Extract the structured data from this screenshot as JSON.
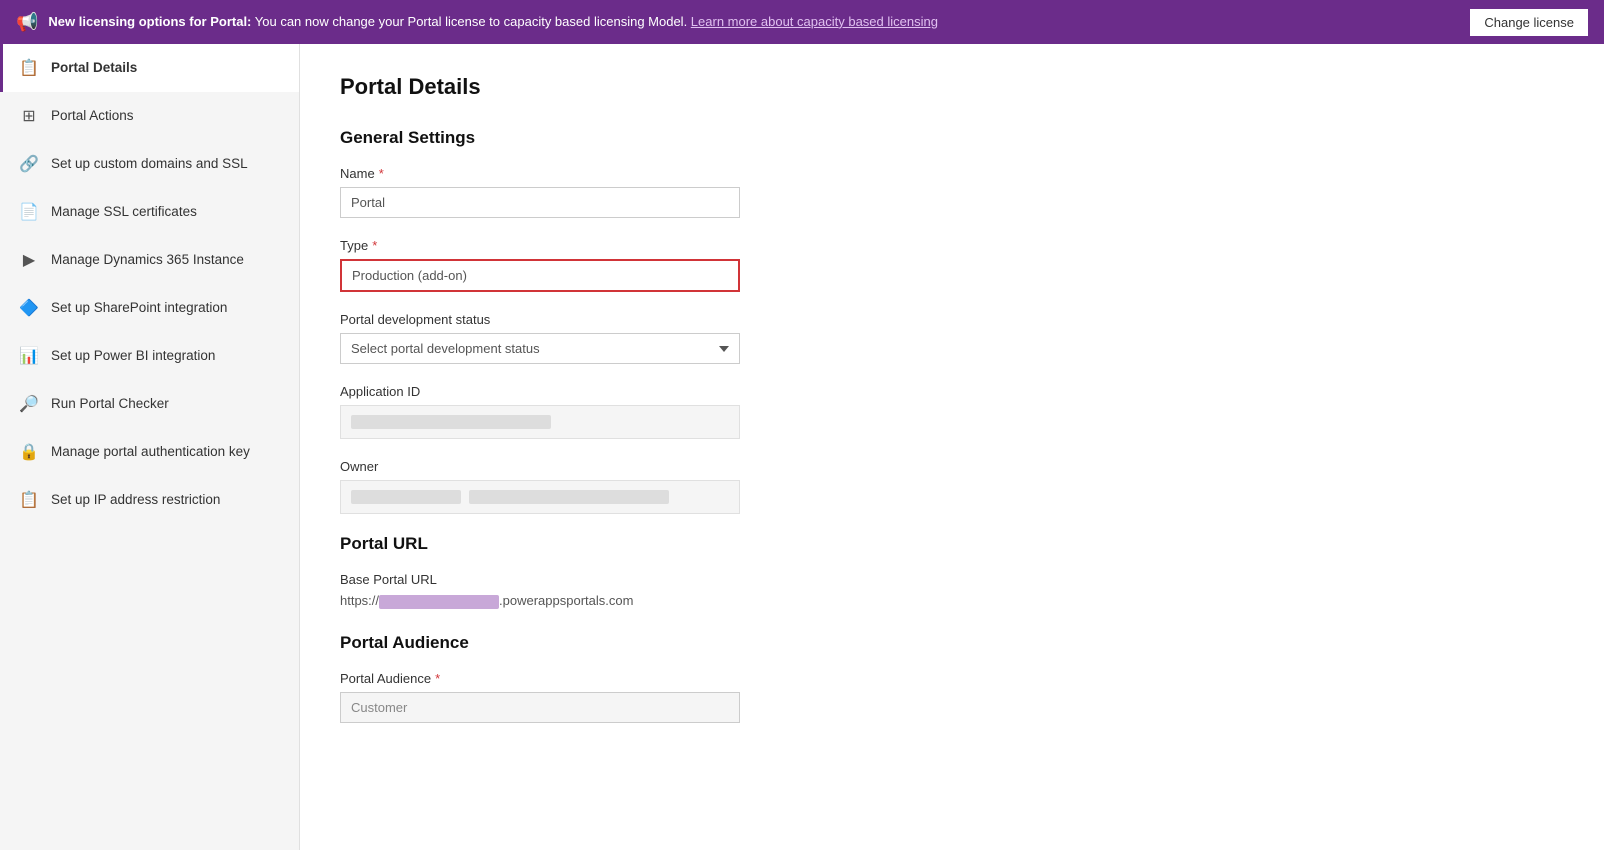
{
  "banner": {
    "icon": "📢",
    "text_prefix": "New licensing options for Portal:",
    "text_body": " You can now change your Portal license to capacity based licensing Model. ",
    "link_text": "Learn more about capacity based licensing",
    "button_label": "Change license"
  },
  "sidebar": {
    "items": [
      {
        "id": "portal-details",
        "label": "Portal Details",
        "icon": "📋",
        "active": true
      },
      {
        "id": "portal-actions",
        "label": "Portal Actions",
        "icon": "⊞",
        "active": false
      },
      {
        "id": "custom-domains",
        "label": "Set up custom domains and SSL",
        "icon": "🔗",
        "active": false
      },
      {
        "id": "ssl-certs",
        "label": "Manage SSL certificates",
        "icon": "📄",
        "active": false
      },
      {
        "id": "dynamics-instance",
        "label": "Manage Dynamics 365 Instance",
        "icon": "▶",
        "active": false
      },
      {
        "id": "sharepoint",
        "label": "Set up SharePoint integration",
        "icon": "🔷",
        "active": false
      },
      {
        "id": "powerbi",
        "label": "Set up Power BI integration",
        "icon": "📊",
        "active": false
      },
      {
        "id": "portal-checker",
        "label": "Run Portal Checker",
        "icon": "🔎",
        "active": false
      },
      {
        "id": "auth-key",
        "label": "Manage portal authentication key",
        "icon": "🔒",
        "active": false
      },
      {
        "id": "ip-restriction",
        "label": "Set up IP address restriction",
        "icon": "📋",
        "active": false
      }
    ]
  },
  "content": {
    "page_title": "Portal Details",
    "general_settings": {
      "section_title": "General Settings",
      "name_label": "Name",
      "name_required": "*",
      "name_value": "Portal",
      "type_label": "Type",
      "type_required": "*",
      "type_value": "Production (add-on)",
      "portal_dev_status_label": "Portal development status",
      "portal_dev_status_placeholder": "Select portal development status",
      "app_id_label": "Application ID",
      "owner_label": "Owner"
    },
    "portal_url": {
      "section_title": "Portal URL",
      "base_url_label": "Base Portal URL",
      "base_url_prefix": "https://",
      "base_url_suffix": ".powerappsportals.com"
    },
    "portal_audience": {
      "section_title": "Portal Audience",
      "audience_label": "Portal Audience",
      "audience_required": "*",
      "audience_value": "Customer"
    }
  }
}
